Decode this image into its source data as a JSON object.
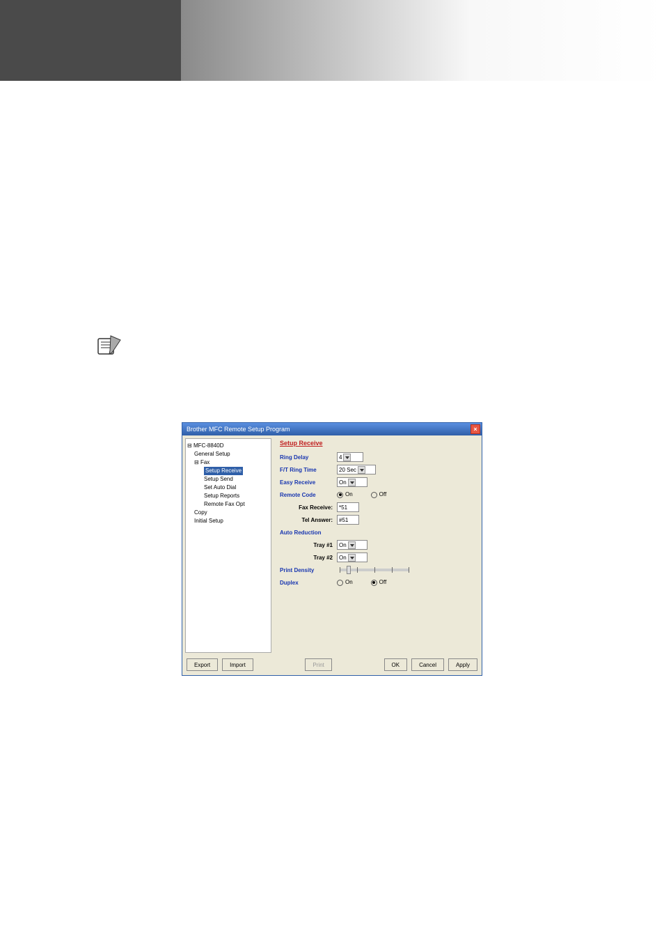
{
  "dialog": {
    "title": "Brother MFC Remote Setup Program",
    "tree": {
      "root": "MFC-8840D",
      "general_setup": "General Setup",
      "fax": "Fax",
      "setup_receive": "Setup Receive",
      "setup_send": "Setup Send",
      "set_auto_dial": "Set Auto Dial",
      "setup_reports": "Setup Reports",
      "remote_fax_opt": "Remote Fax Opt",
      "copy": "Copy",
      "initial_setup": "Initial Setup"
    },
    "form": {
      "header": "Setup Receive",
      "ring_delay_label": "Ring Delay",
      "ring_delay_value": "4",
      "ft_ring_time_label": "F/T Ring Time",
      "ft_ring_time_value": "20 Sec",
      "easy_receive_label": "Easy Receive",
      "easy_receive_value": "On",
      "remote_code_label": "Remote Code",
      "remote_code_on": "On",
      "remote_code_off": "Off",
      "fax_receive_label": "Fax Receive:",
      "fax_receive_value": "*51",
      "tel_answer_label": "Tel Answer:",
      "tel_answer_value": "#51",
      "auto_reduction_label": "Auto Reduction",
      "tray1_label": "Tray #1",
      "tray1_value": "On",
      "tray2_label": "Tray #2",
      "tray2_value": "On",
      "print_density_label": "Print Density",
      "duplex_label": "Duplex",
      "duplex_on": "On",
      "duplex_off": "Off"
    },
    "buttons": {
      "export": "Export",
      "import": "Import",
      "print": "Print",
      "ok": "OK",
      "cancel": "Cancel",
      "apply": "Apply"
    }
  },
  "chart_data": null
}
